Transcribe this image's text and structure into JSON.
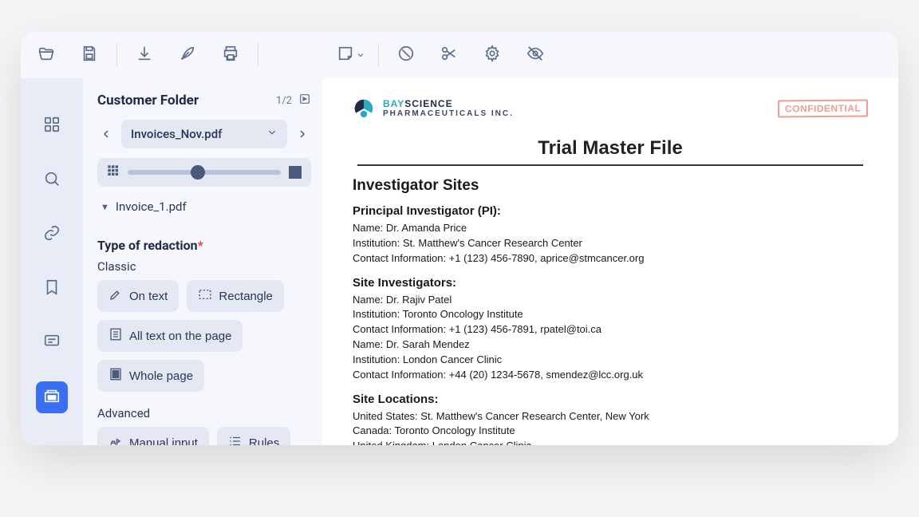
{
  "toolbar": {
    "open_hint": "Open",
    "save_hint": "Save",
    "download_hint": "Download",
    "sign_hint": "Sign",
    "print_hint": "Print",
    "note_hint": "Add note",
    "eraser_hint": "Eraser",
    "scissors_hint": "Cut",
    "settings_hint": "Settings",
    "hide_hint": "Hide"
  },
  "rail": {
    "thumbs_hint": "Thumbnails",
    "search_hint": "Search",
    "links_hint": "Attachments",
    "bookmarks_hint": "Bookmarks",
    "comments_hint": "Comments",
    "redact_hint": "Redaction"
  },
  "sidebar": {
    "title": "Customer Folder",
    "page_counter": "1/2",
    "current_file": "Invoices_Nov.pdf",
    "tree_file": "Invoice_1.pdf",
    "type_label": "Type of redaction",
    "classic_label": "Classic",
    "advanced_label": "Advanced",
    "buttons": {
      "on_text": "On text",
      "rectangle": "Rectangle",
      "all_text": "All text on the page",
      "whole_page": "Whole page",
      "manual_input": "Manual input",
      "rules": "Rules"
    }
  },
  "document": {
    "logo_line1_a": "BAY",
    "logo_line1_b": "SCIENCE",
    "logo_line2": "PHARMACEUTICALS INC.",
    "stamp": "CONFIDENTIAL",
    "title": "Trial Master File",
    "section1": "Investigator Sites",
    "pi_heading": "Principal Investigator (PI):",
    "pi_name": "Name: Dr. Amanda Price",
    "pi_inst": "Institution: St. Matthew's Cancer Research Center",
    "pi_contact": "Contact Information: +1 (123) 456-7890, aprice@stmcancer.org",
    "si_heading": "Site Investigators:",
    "si1_name": "Name: Dr. Rajiv Patel",
    "si1_inst": "Institution: Toronto Oncology Institute",
    "si1_contact": "Contact Information: +1 (123) 456-7891, rpatel@toi.ca",
    "si2_name": "Name: Dr. Sarah Mendez",
    "si2_inst": "Institution: London Cancer Clinic",
    "si2_contact": "Contact Information: +44 (20) 1234-5678, smendez@lcc.org.uk",
    "loc_heading": "Site Locations:",
    "loc1": "United States: St. Matthew's Cancer Research Center, New York",
    "loc2": "Canada: Toronto Oncology Institute",
    "loc3": "United Kingdom: London Cancer Clinic"
  }
}
